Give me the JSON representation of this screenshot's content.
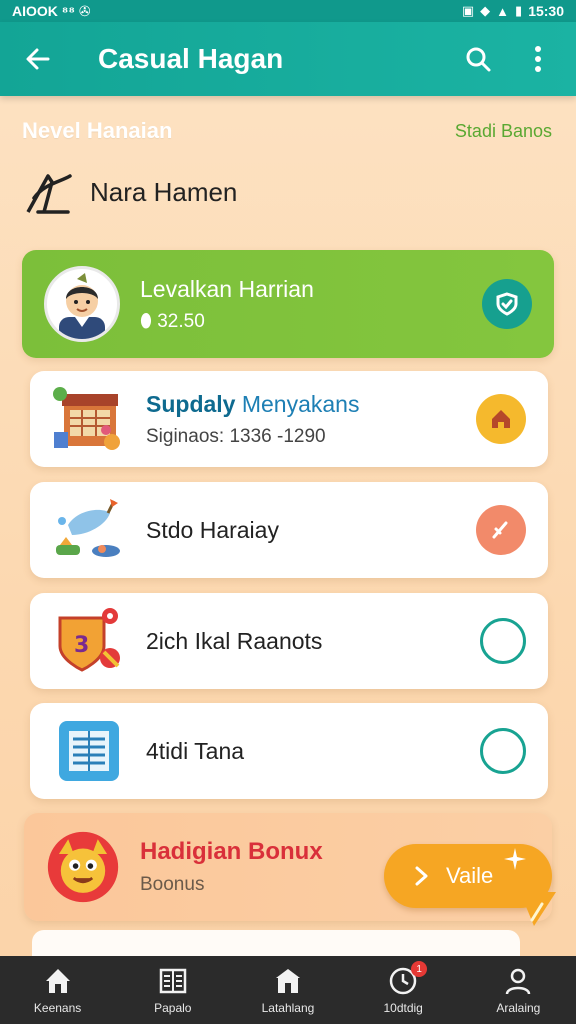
{
  "status_bar": {
    "left_text": "AIOOK ⁸⁸ ✇",
    "time": "15:30"
  },
  "app_bar": {
    "title": "Casual Hagan"
  },
  "section": {
    "title": "Nevel Hanaian",
    "link": "Stadi Banos"
  },
  "user": {
    "name": "Nara Hamen"
  },
  "cards": [
    {
      "title": "Levalkan Harrian",
      "subtitle": "32.50",
      "status": "done"
    },
    {
      "title_a": "Supdaly",
      "title_b": "Menyakans",
      "subtitle": "Siginaos: 1336 -1290",
      "status": "home"
    },
    {
      "title": "Stdo Haraiay",
      "subtitle": "",
      "status": "edit"
    },
    {
      "title": "2ich Ikal Raanots",
      "subtitle": "",
      "status": "empty"
    },
    {
      "title": "4tidi Tana",
      "subtitle": "",
      "status": "empty"
    },
    {
      "title": "Hadigian Bonux",
      "subtitle": "Boonus",
      "status": "none"
    }
  ],
  "fab": {
    "label": "Vaile"
  },
  "nav": [
    {
      "label": "Keenans",
      "icon": "home-icon"
    },
    {
      "label": "Papalo",
      "icon": "book-icon"
    },
    {
      "label": "Latahlang",
      "icon": "store-icon"
    },
    {
      "label": "10dtdig",
      "icon": "clock-icon",
      "badge": "1"
    },
    {
      "label": "Aralaing",
      "icon": "profile-icon"
    }
  ],
  "colors": {
    "primary": "#13a596",
    "green_card": "#7cbf3a",
    "fab": "#f6a623",
    "accent_red": "#d9303a"
  }
}
